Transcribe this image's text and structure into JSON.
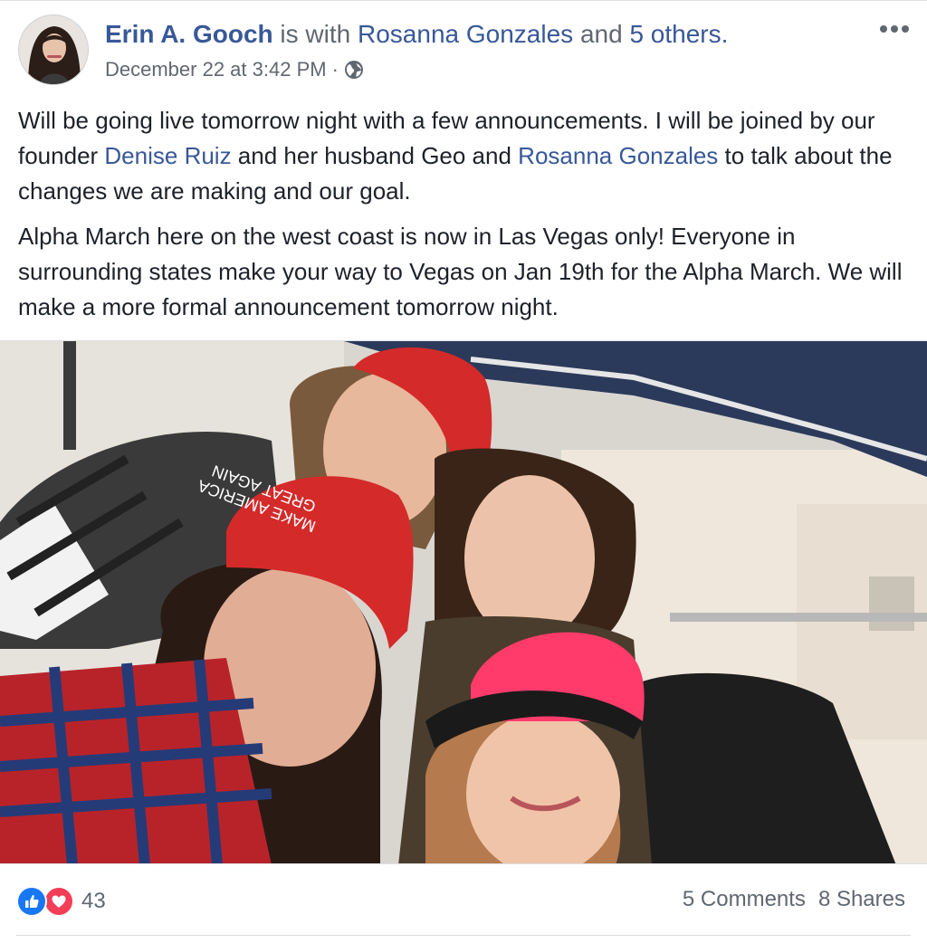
{
  "post": {
    "author": "Erin A. Gooch",
    "with_text": "is with",
    "tagged_name": "Rosanna Gonzales",
    "and_text": "and",
    "others_link": "5 others.",
    "timestamp": "December 22 at 3:42 PM",
    "separator": "·",
    "privacy_icon": "globe-icon",
    "more_icon": "more-options-icon",
    "paragraph1": {
      "part1": "Will be going live tomorrow night with a few announcements. I will be joined by our founder ",
      "link1": "Denise Ruiz",
      "part2": " and her husband Geo and ",
      "link2": "Rosanna Gonzales",
      "part3": " to talk about the changes we are making and our goal."
    },
    "paragraph2": "Alpha March here on the west coast is now in Las Vegas only! Everyone in surrounding states make your way to Vegas on Jan 19th for the Alpha March. We will make a more formal announcement tomorrow night.",
    "photo": {
      "hat_text_1": "MAKE AMERICA",
      "hat_text_2": "GREAT AGAIN"
    }
  },
  "footer": {
    "reaction_icons": [
      "like-icon",
      "love-icon"
    ],
    "reaction_count": "43",
    "comments": "5 Comments",
    "shares": "8 Shares"
  },
  "colors": {
    "link": "#385898",
    "text": "#1d2129",
    "meta": "#616770",
    "like": "#1877f2",
    "love": "#f33e58"
  }
}
